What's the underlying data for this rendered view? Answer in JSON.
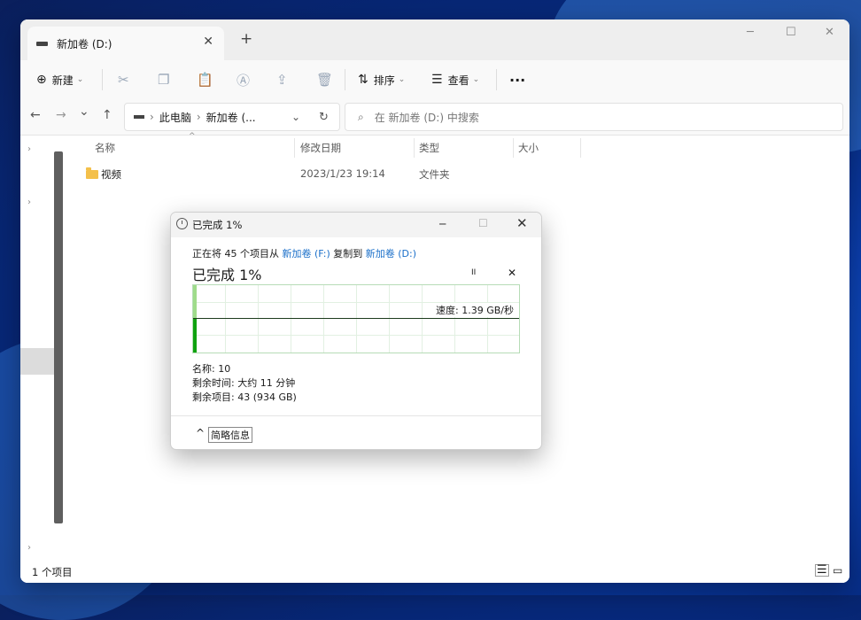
{
  "window": {
    "tab_title": "新加卷 (D:)",
    "tab_close": "✕",
    "new_tab": "+",
    "minimize": "─",
    "maximize": "☐",
    "close": "✕"
  },
  "toolbar": {
    "new_label": "新建",
    "sort_label": "排序",
    "view_label": "查看",
    "more": "···"
  },
  "address": {
    "back": "←",
    "forward": "→",
    "recent": "⌄",
    "up": "↑",
    "crumb_1": "此电脑",
    "crumb_2": "新加卷 (...",
    "refresh": "↻",
    "search_placeholder": "在 新加卷 (D:) 中搜索"
  },
  "columns": {
    "name": "名称",
    "modified": "修改日期",
    "type": "类型",
    "size": "大小"
  },
  "files": [
    {
      "name": "视频",
      "modified": "2023/1/23 19:14",
      "type": "文件夹",
      "size": ""
    }
  ],
  "status": {
    "item_count": "1 个项目"
  },
  "copy_dialog": {
    "title": "已完成 1%",
    "desc_prefix": "正在将 45 个项目从",
    "source": "新加卷 (F:)",
    "desc_mid": "复制到",
    "dest": "新加卷 (D:)",
    "heading": "已完成 1%",
    "pause": "II",
    "cancel": "✕",
    "speed": "速度: 1.39 GB/秒",
    "progress_fraction": 0.01,
    "name_line": "名称: 10",
    "time_line": "剩余时间: 大约 11 分钟",
    "items_line": "剩余项目: 43 (934 GB)",
    "details_button": "简略信息",
    "collapse": "^"
  }
}
